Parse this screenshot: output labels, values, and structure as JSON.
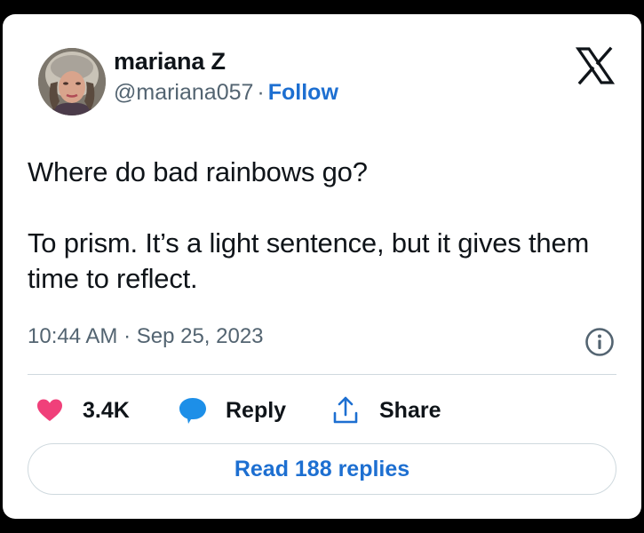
{
  "author": {
    "name": "mariana Z",
    "handle": "@mariana057",
    "separator": "·",
    "follow_label": "Follow"
  },
  "tweet": {
    "paragraphs": [
      "Where do bad rainbows go?",
      "To prism. It’s a light sentence, but it gives them time to reflect."
    ],
    "timestamp": "10:44 AM · Sep 25, 2023"
  },
  "actions": {
    "like_count": "3.4K",
    "reply_label": "Reply",
    "share_label": "Share"
  },
  "footer": {
    "read_replies_label": "Read 188 replies"
  },
  "icons": {
    "logo": "x-logo-icon",
    "info": "info-icon",
    "like": "heart-icon",
    "reply": "speech-bubble-icon",
    "share": "share-upload-icon"
  },
  "colors": {
    "accent": "#1d6fd1",
    "heart": "#f0407a",
    "reply_bubble": "#1d8fe8",
    "text": "#0f1419",
    "muted": "#536471",
    "border": "#cfd9de"
  }
}
